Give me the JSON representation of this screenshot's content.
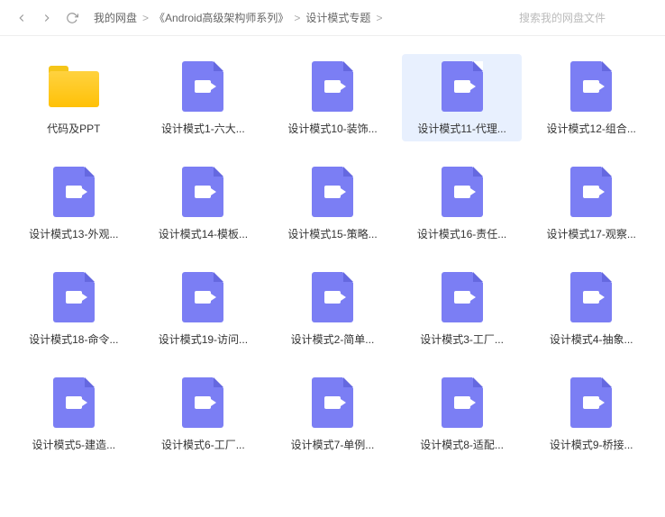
{
  "nav": {
    "back": "back-icon",
    "forward": "forward-icon",
    "refresh": "refresh-icon"
  },
  "breadcrumb": {
    "root": "我的网盘",
    "path1": "《Android高级架构师系列》",
    "path2": "设计模式专题",
    "sep": ">"
  },
  "search": {
    "placeholder": "搜索我的网盘文件"
  },
  "items": [
    {
      "type": "folder",
      "label": "代码及PPT"
    },
    {
      "type": "video",
      "label": "设计模式1-六大..."
    },
    {
      "type": "video",
      "label": "设计模式10-装饰..."
    },
    {
      "type": "video",
      "label": "设计模式11-代理...",
      "selected": true
    },
    {
      "type": "video",
      "label": "设计模式12-组合..."
    },
    {
      "type": "video",
      "label": "设计模式13-外观..."
    },
    {
      "type": "video",
      "label": "设计模式14-模板..."
    },
    {
      "type": "video",
      "label": "设计模式15-策略..."
    },
    {
      "type": "video",
      "label": "设计模式16-责任..."
    },
    {
      "type": "video",
      "label": "设计模式17-观察..."
    },
    {
      "type": "video",
      "label": "设计模式18-命令..."
    },
    {
      "type": "video",
      "label": "设计模式19-访问..."
    },
    {
      "type": "video",
      "label": "设计模式2-简单..."
    },
    {
      "type": "video",
      "label": "设计模式3-工厂..."
    },
    {
      "type": "video",
      "label": "设计模式4-抽象..."
    },
    {
      "type": "video",
      "label": "设计模式5-建造..."
    },
    {
      "type": "video",
      "label": "设计模式6-工厂..."
    },
    {
      "type": "video",
      "label": "设计模式7-单例..."
    },
    {
      "type": "video",
      "label": "设计模式8-适配..."
    },
    {
      "type": "video",
      "label": "设计模式9-桥接..."
    }
  ]
}
